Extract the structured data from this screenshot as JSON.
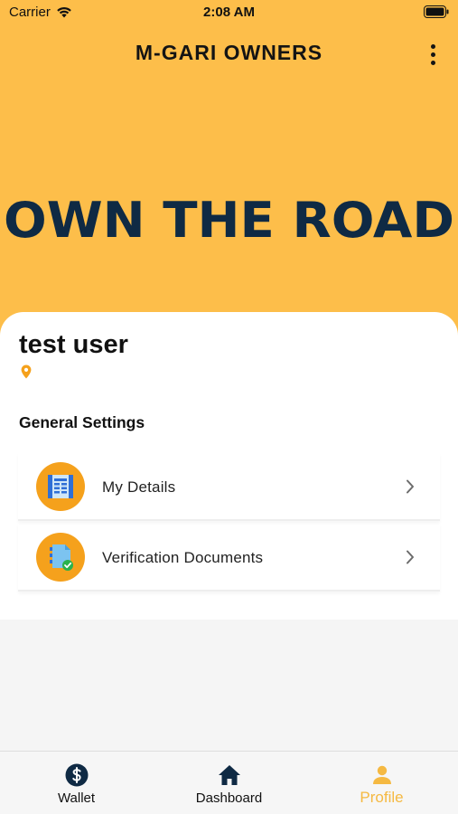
{
  "status_bar": {
    "carrier": "Carrier",
    "time": "2:08 AM"
  },
  "header": {
    "title": "M-GARI OWNERS",
    "menu_icon": "more-vertical-icon"
  },
  "hero": {
    "slogan": "OWN THE ROAD",
    "background_color": "#FDBE4A",
    "slogan_color": "#0f2a44"
  },
  "profile": {
    "name": "test user",
    "location_icon": "location-pin-icon",
    "location_color": "#F5A11C"
  },
  "settings": {
    "title": "General Settings",
    "items": [
      {
        "label": "My Details",
        "icon": "id-card-icon"
      },
      {
        "label": "Verification Documents",
        "icon": "verified-document-icon"
      }
    ]
  },
  "tab_bar": {
    "tabs": [
      {
        "label": "Wallet",
        "icon": "dollar-icon",
        "active": false
      },
      {
        "label": "Dashboard",
        "icon": "home-icon",
        "active": false
      },
      {
        "label": "Profile",
        "icon": "person-icon",
        "active": true
      }
    ],
    "active_color": "#F5B942",
    "inactive_icon_color": "#0f2a44"
  }
}
